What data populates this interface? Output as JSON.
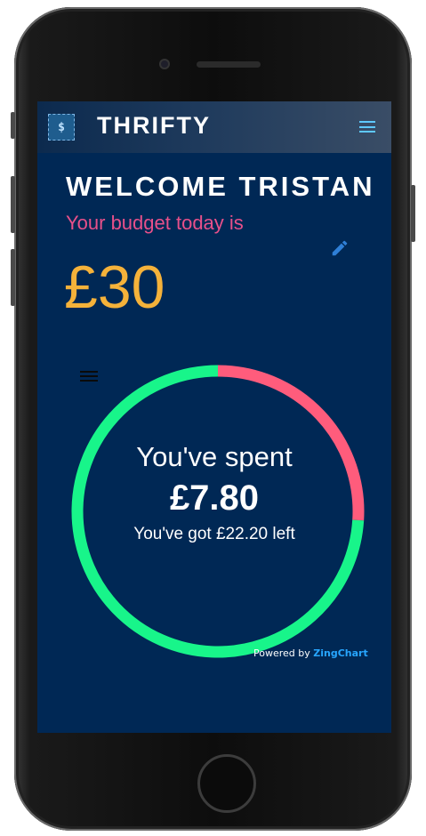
{
  "header": {
    "logo_text": "$",
    "app_title": "THRIFTY",
    "menu_icon": "hamburger-menu-icon"
  },
  "main": {
    "welcome": "WELCOME TRISTAN",
    "budget_label": "Your budget today is",
    "budget_value": "£30",
    "edit_icon": "pencil-edit-icon"
  },
  "chart_data": {
    "type": "pie",
    "donut": true,
    "slices": [
      {
        "label": "Spent",
        "value": 7.8,
        "color": "#ff5c7c"
      },
      {
        "label": "Left",
        "value": 22.2,
        "color": "#18f58a"
      }
    ],
    "total": 30,
    "center_text": {
      "line1": "You've spent",
      "line2": "£7.80",
      "line3": "You've got £22.20 left"
    },
    "credit": {
      "prefix": "Powered by",
      "brand": "ZingChart"
    }
  },
  "colors": {
    "background": "#002855",
    "accent": "#5ec8ff",
    "budget": "#f5b23a",
    "subtitle": "#e8508a",
    "spent": "#ff5c7c",
    "left": "#18f58a"
  }
}
